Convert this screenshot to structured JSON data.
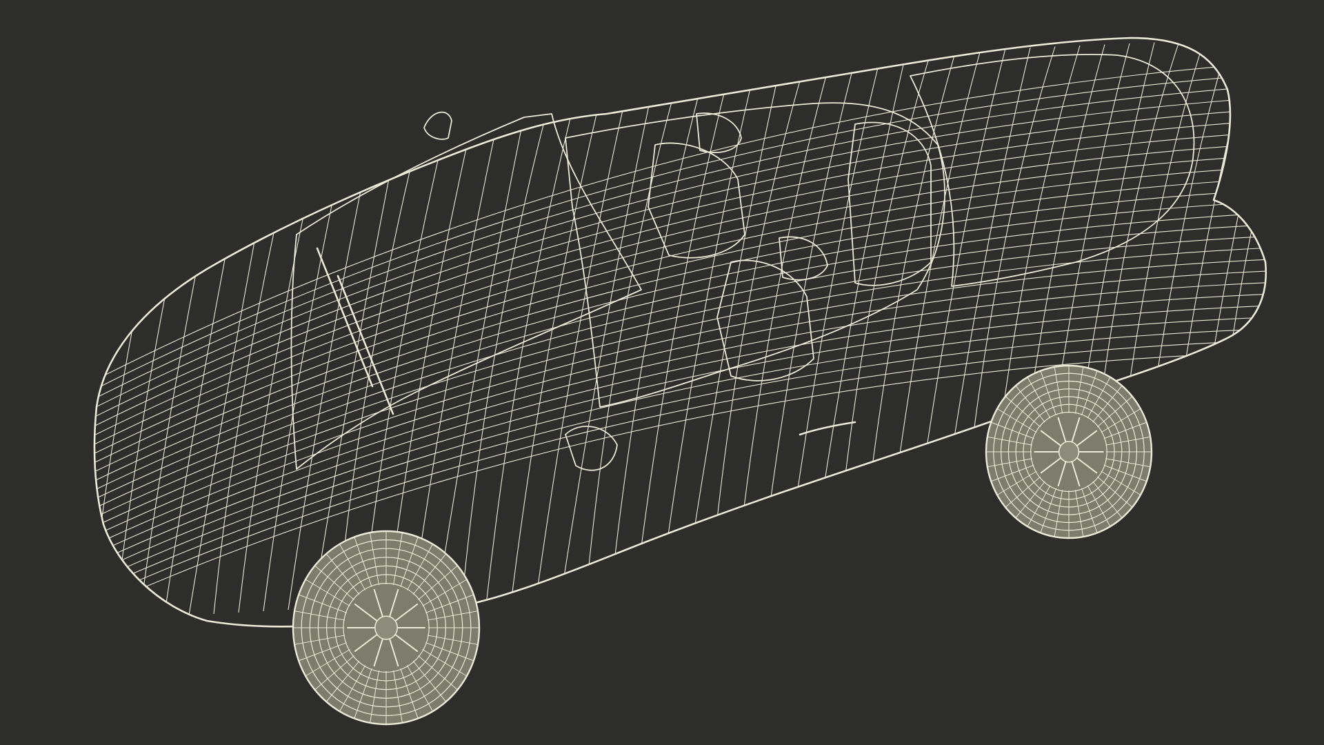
{
  "scene": {
    "background_color": "#2d2d2b",
    "model_fill_color": "#8c8c7c",
    "model_shade_color": "#6f6f62",
    "model_light_color": "#a3a392",
    "wireframe_color": "#ecebd8",
    "subject": "convertible-car-wireframe"
  }
}
